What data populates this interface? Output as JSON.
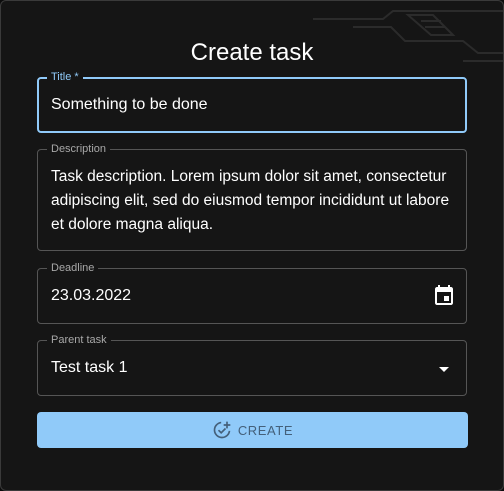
{
  "dialog": {
    "title": "Create task"
  },
  "fields": {
    "title": {
      "label": "Title *",
      "value": "Something to be done"
    },
    "description": {
      "label": "Description",
      "value": "Task description. Lorem ipsum dolor sit amet, consectetur adipiscing elit, sed do eiusmod tempor incididunt ut labore et dolore magna aliqua."
    },
    "deadline": {
      "label": "Deadline",
      "value": "23.03.2022",
      "icon": "calendar-icon"
    },
    "parent": {
      "label": "Parent task",
      "value": "Test task 1",
      "icon": "arrow-drop-down-icon"
    }
  },
  "actions": {
    "create_label": "CREATE",
    "create_icon": "add-task-icon"
  },
  "colors": {
    "accent": "#90caf9",
    "background": "#151515",
    "border": "#555555",
    "text": "#ffffff",
    "button_text": "#44607a"
  }
}
